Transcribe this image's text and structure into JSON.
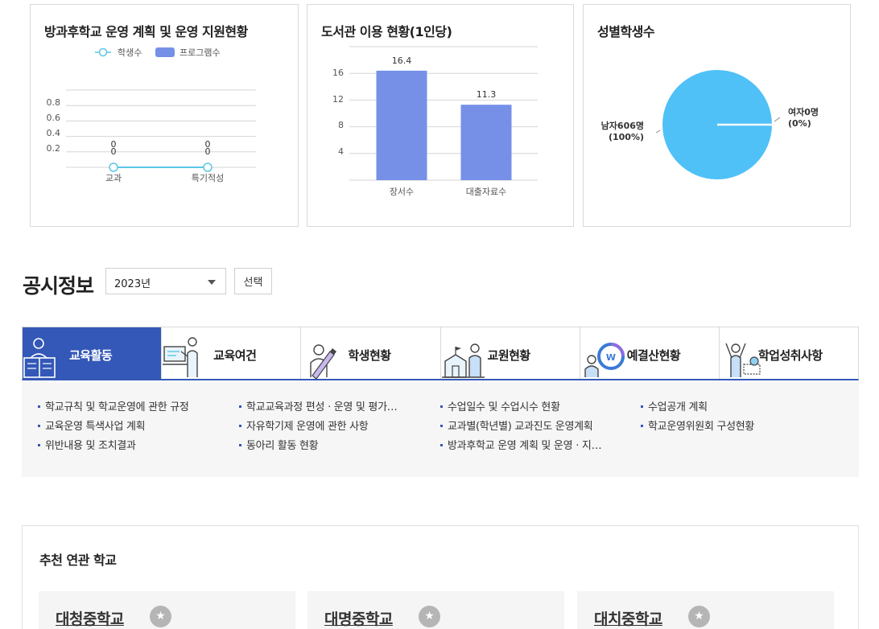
{
  "charts": {
    "afterschool": {
      "title": "방과후학교 운영 계획 및 운영 지원현황",
      "legend": [
        "학생수",
        "프로그램수"
      ],
      "y_ticks": [
        "0.8",
        "0.6",
        "0.4",
        "0.2"
      ],
      "categories": [
        "교과",
        "특기적성"
      ],
      "point_labels": [
        "0",
        "0"
      ]
    },
    "library": {
      "title": "도서관 이용 현황(1인당)",
      "y_ticks": [
        "16",
        "12",
        "8",
        "4"
      ],
      "categories": [
        "장서수",
        "대출자료수"
      ],
      "value_labels": [
        "16.4",
        "11.3"
      ]
    },
    "gender": {
      "title": "성별학생수",
      "male_label": "남자606명",
      "male_pct": "(100%)",
      "female_label": "여자0명",
      "female_pct": "(0%)"
    }
  },
  "chart_data": [
    {
      "type": "line",
      "title": "방과후학교 운영 계획 및 운영 지원현황",
      "categories": [
        "교과",
        "특기적성"
      ],
      "series": [
        {
          "name": "학생수",
          "values": [
            0,
            0
          ]
        },
        {
          "name": "프로그램수",
          "values": [
            0,
            0
          ]
        }
      ],
      "ylim": [
        0,
        1
      ]
    },
    {
      "type": "bar",
      "title": "도서관 이용 현황(1인당)",
      "categories": [
        "장서수",
        "대출자료수"
      ],
      "values": [
        16.4,
        11.3
      ],
      "ylim": [
        0,
        20
      ]
    },
    {
      "type": "pie",
      "title": "성별학생수",
      "categories": [
        "남자",
        "여자"
      ],
      "values": [
        606,
        0
      ]
    }
  ],
  "colors": {
    "accent": "#3458b8",
    "bar": "#7690e8",
    "pie": "#4fc1f7",
    "line": "#5cc6e6"
  },
  "disclosure": {
    "title": "공시정보",
    "year": "2023년",
    "select_button": "선택",
    "tabs": [
      {
        "label": "교육활동",
        "icon": "student-reading-icon"
      },
      {
        "label": "교육여건",
        "icon": "teacher-board-icon"
      },
      {
        "label": "학생현황",
        "icon": "student-pencil-icon"
      },
      {
        "label": "교원현황",
        "icon": "school-building-icon"
      },
      {
        "label": "예결산현황",
        "icon": "budget-coin-icon"
      },
      {
        "label": "학업성취사항",
        "icon": "achievement-trophy-icon"
      }
    ],
    "links": [
      [
        "학교규칙 및 학교운영에 관한 규정",
        "교육운영 특색사업 계획",
        "위반내용 및 조치결과"
      ],
      [
        "학교교육과정 편성ㆍ운영 및 평가…",
        "자유학기제 운영에 관한 사항",
        "동아리 활동 현황"
      ],
      [
        "수업일수 및 수업시수 현황",
        "교과별(학년별) 교과진도 운영계획",
        "방과후학교 운영 계획 및 운영ㆍ지…"
      ],
      [
        "수업공개 계획",
        "학교운영위원회 구성현황"
      ]
    ]
  },
  "recommend": {
    "title": "추천 연관 학교",
    "schools": [
      "대청중학교",
      "대명중학교",
      "대치중학교"
    ]
  }
}
